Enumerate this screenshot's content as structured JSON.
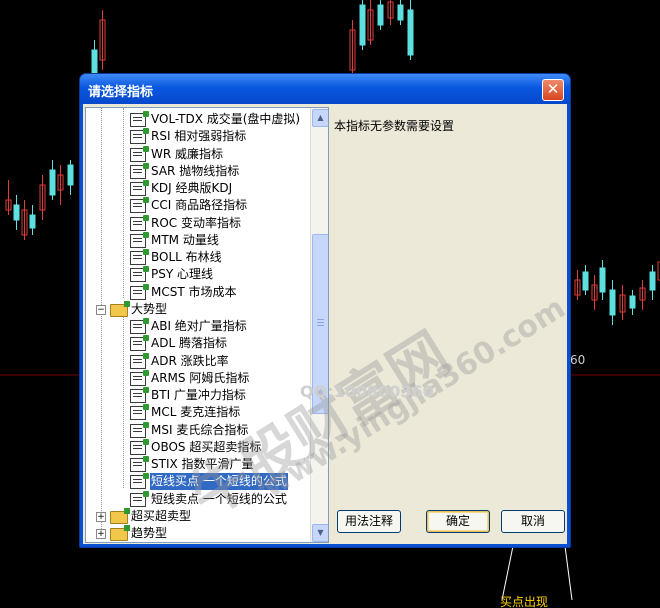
{
  "dialog": {
    "title": "请选择指标",
    "close_label": "✕",
    "info_text": "本指标无参数需要设置",
    "buttons": {
      "usage": "用法注释",
      "ok": "确定",
      "cancel": "取消"
    }
  },
  "tree": {
    "items": [
      {
        "label": "VOL-TDX 成交量(盘中虚拟)",
        "level": 2
      },
      {
        "label": "RSI 相对强弱指标",
        "level": 2
      },
      {
        "label": "WR 威廉指标",
        "level": 2
      },
      {
        "label": "SAR 抛物线指标",
        "level": 2
      },
      {
        "label": "KDJ 经典版KDJ",
        "level": 2
      },
      {
        "label": "CCI 商品路径指标",
        "level": 2
      },
      {
        "label": "ROC 变动率指标",
        "level": 2
      },
      {
        "label": "MTM 动量线",
        "level": 2
      },
      {
        "label": "BOLL 布林线",
        "level": 2
      },
      {
        "label": "PSY 心理线",
        "level": 2
      },
      {
        "label": "MCST 市场成本",
        "level": 2
      },
      {
        "label": "大势型",
        "level": 1,
        "group": true,
        "expanded": true
      },
      {
        "label": "ABI 绝对广量指标",
        "level": 2
      },
      {
        "label": "ADL 腾落指标",
        "level": 2
      },
      {
        "label": "ADR 涨跌比率",
        "level": 2
      },
      {
        "label": "ARMS 阿姆氏指标",
        "level": 2
      },
      {
        "label": "BTI 广量冲力指标",
        "level": 2
      },
      {
        "label": "MCL 麦克连指标",
        "level": 2
      },
      {
        "label": "MSI 麦氏综合指标",
        "level": 2
      },
      {
        "label": "OBOS 超买超卖指标",
        "level": 2
      },
      {
        "label": "STIX 指数平滑广量",
        "level": 2
      },
      {
        "label": "短线买点 一个短线的公式",
        "level": 2,
        "selected": true
      },
      {
        "label": "短线卖点 一个短线的公式",
        "level": 2
      },
      {
        "label": "超买超卖型",
        "level": 1,
        "group": true,
        "expanded": false
      },
      {
        "label": "趋势型",
        "level": 1,
        "group": true,
        "expanded": false
      }
    ]
  },
  "background": {
    "axis_value": "60",
    "annotation": "买点出现"
  },
  "watermark": {
    "brand": "牛股财富网",
    "url": "www.yingjia360.com",
    "qq": "QQ:100800360"
  },
  "colors": {
    "title_bar": "#0a57e0",
    "selection": "#316ac5",
    "candle_up": "#e23b3b",
    "candle_down": "#5fe0e0"
  }
}
